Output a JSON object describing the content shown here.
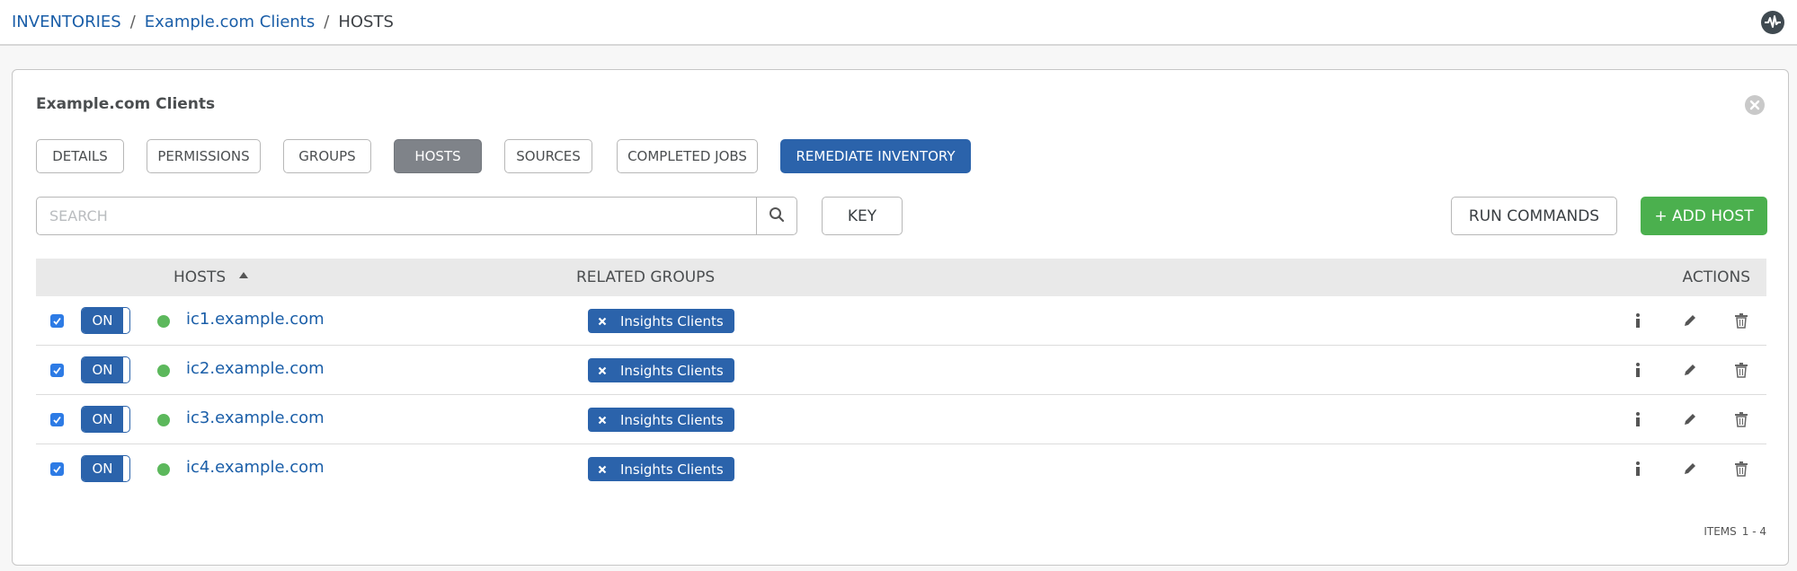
{
  "breadcrumb": {
    "inventories": "INVENTORIES",
    "inventory": "Example.com Clients",
    "current": "HOSTS",
    "separator": "/"
  },
  "panel": {
    "title": "Example.com Clients"
  },
  "tabs": {
    "details": "DETAILS",
    "permissions": "PERMISSIONS",
    "groups": "GROUPS",
    "hosts": "HOSTS",
    "sources": "SOURCES",
    "completed_jobs": "COMPLETED JOBS",
    "remediate": "REMEDIATE INVENTORY",
    "active": "HOSTS"
  },
  "search": {
    "placeholder": "SEARCH",
    "value": ""
  },
  "buttons": {
    "key": "KEY",
    "run_commands": "RUN COMMANDS",
    "add_host": "+ ADD HOST"
  },
  "table": {
    "headers": {
      "hosts": "HOSTS",
      "related_groups": "RELATED GROUPS",
      "actions": "ACTIONS"
    },
    "sort": "hosts-ascending",
    "rows": [
      {
        "selected": true,
        "toggle": "ON",
        "status": "ok",
        "host": "ic1.example.com",
        "group": "Insights Clients"
      },
      {
        "selected": true,
        "toggle": "ON",
        "status": "ok",
        "host": "ic2.example.com",
        "group": "Insights Clients"
      },
      {
        "selected": true,
        "toggle": "ON",
        "status": "ok",
        "host": "ic3.example.com",
        "group": "Insights Clients"
      },
      {
        "selected": true,
        "toggle": "ON",
        "status": "ok",
        "host": "ic4.example.com",
        "group": "Insights Clients"
      }
    ]
  },
  "pager": {
    "label": "ITEMS",
    "range": "1 - 4"
  },
  "icons": {
    "activity": "activity-stream-icon",
    "close": "close-icon",
    "search": "search-icon",
    "sort": "sort-ascending-icon",
    "info": "info-icon",
    "edit": "pencil-icon",
    "delete": "trash-icon",
    "tag_remove": "x-icon",
    "checkbox": "checkbox-checked-icon"
  },
  "colors": {
    "link": "#1a5ea8",
    "primary": "#2b63ab",
    "success": "#4bb04e",
    "status_ok": "#5cb85c",
    "active_tab": "#7f8389"
  }
}
